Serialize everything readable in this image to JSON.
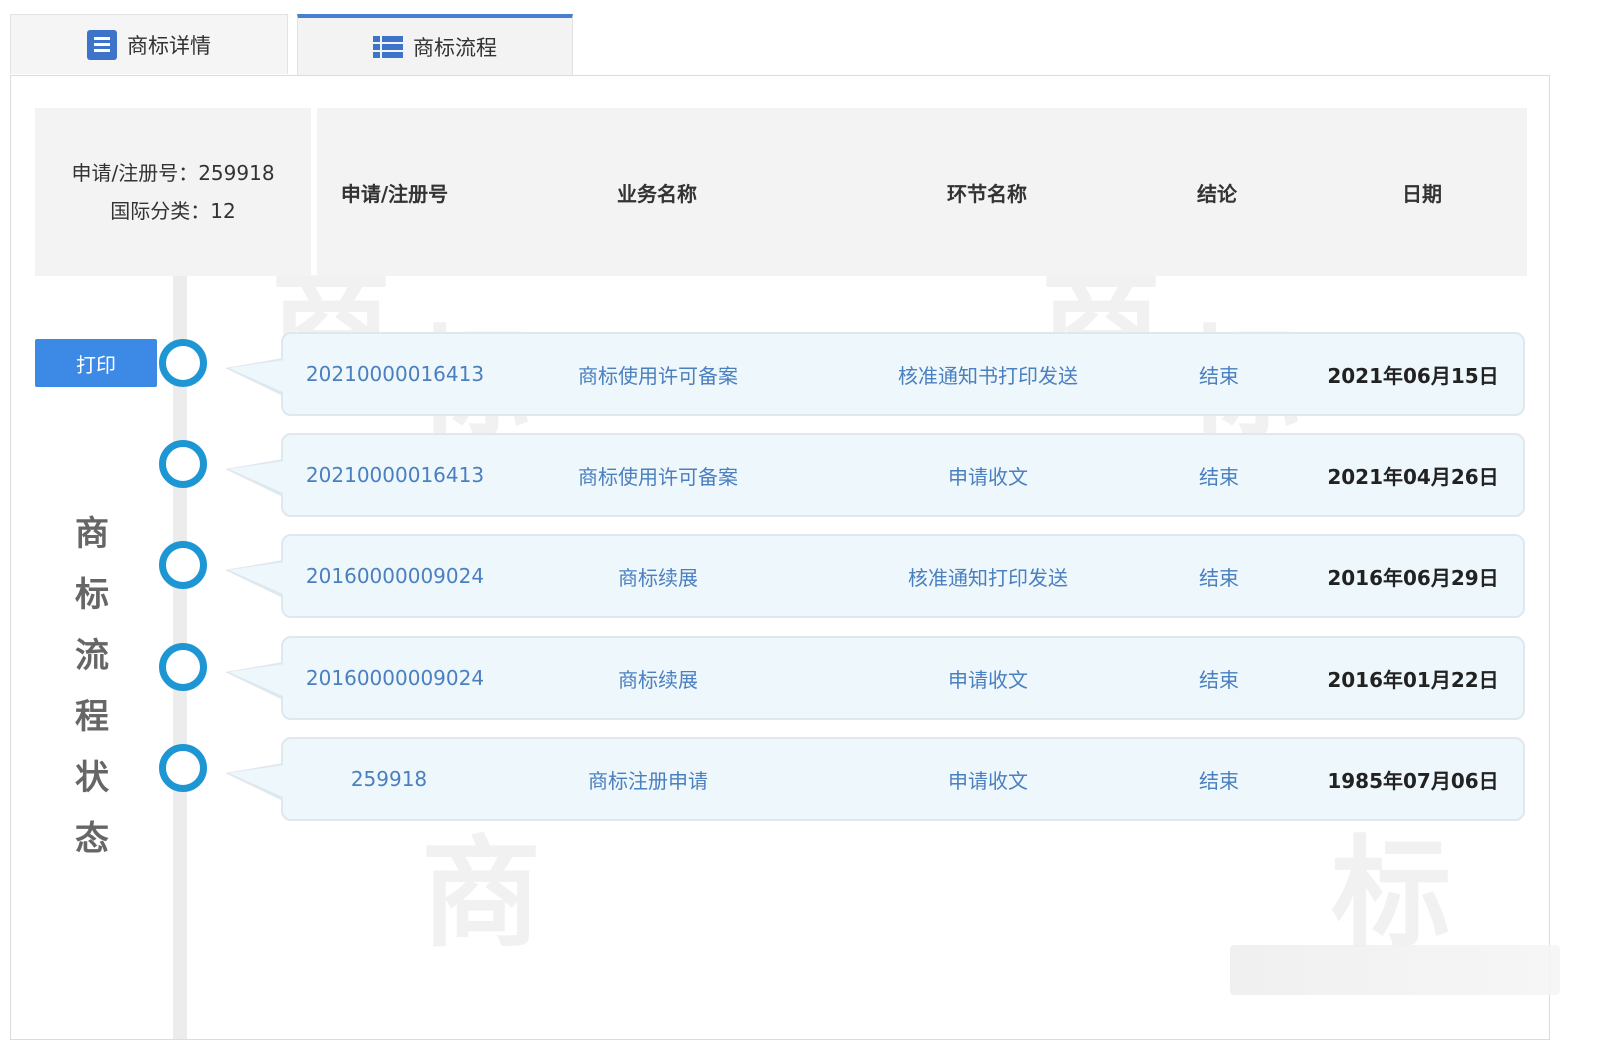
{
  "tabs": [
    {
      "label": "商标详情",
      "icon": "document-list-icon"
    },
    {
      "label": "商标流程",
      "icon": "list-icon"
    }
  ],
  "info": {
    "reg_no": "申请/注册号：259918",
    "intl_class": "国际分类：12"
  },
  "headers": {
    "app_no": "申请/注册号",
    "business": "业务名称",
    "step": "环节名称",
    "conclusion": "结论",
    "date": "日期"
  },
  "print_label": "打印",
  "vertical_title": [
    "商",
    "标",
    "流",
    "程",
    "状",
    "态"
  ],
  "watermark_chars": [
    "商",
    "标",
    "商",
    "标",
    "商",
    "标"
  ],
  "rows": [
    {
      "app_no": "20210000016413",
      "business": "商标使用许可备案",
      "step": "核准通知书打印发送",
      "conclusion": "结束",
      "date": "2021年06月15日"
    },
    {
      "app_no": "20210000016413",
      "business": "商标使用许可备案",
      "step": "申请收文",
      "conclusion": "结束",
      "date": "2021年04月26日"
    },
    {
      "app_no": "20160000009024",
      "business": "商标续展",
      "step": "核准通知打印发送",
      "conclusion": "结束",
      "date": "2016年06月29日"
    },
    {
      "app_no": "20160000009024",
      "business": "商标续展",
      "step": "申请收文",
      "conclusion": "结束",
      "date": "2016年01月22日"
    },
    {
      "app_no": "259918",
      "business": "商标注册申请",
      "step": "申请收文",
      "conclusion": "结束",
      "date": "1985年07月06日"
    }
  ],
  "colors": {
    "accent": "#3d8ae6",
    "node": "#1d96d3",
    "link_text": "#4a7fc0",
    "row_bg": "#eef7fb"
  }
}
